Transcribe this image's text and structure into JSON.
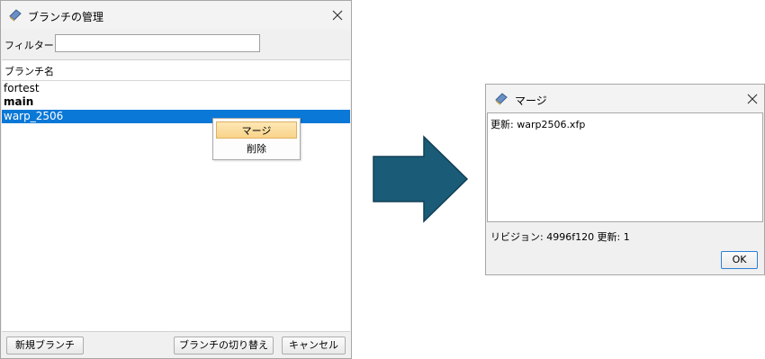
{
  "branch_dialog": {
    "title": "ブランチの管理",
    "filter_label": "フィルター:",
    "filter_value": "",
    "column_header": "ブランチ名",
    "branches": [
      {
        "name": "fortest",
        "bold": false,
        "selected": false
      },
      {
        "name": "main",
        "bold": true,
        "selected": false
      },
      {
        "name": "warp_2506",
        "bold": false,
        "selected": true
      }
    ],
    "context_menu": {
      "merge": "マージ",
      "delete": "削除"
    },
    "buttons": {
      "new_branch": "新規ブランチ",
      "switch_branch": "ブランチの切り替え",
      "cancel": "キャンセル"
    }
  },
  "merge_dialog": {
    "title": "マージ",
    "message": "更新: warp2506.xfp",
    "revision": "リビジョン: 4996f120 更新: 1",
    "ok": "OK"
  },
  "colors": {
    "selection": "#0a78d7",
    "arrow": "#1a5c78",
    "menu_highlight": "#f9d38a"
  },
  "icons": [
    "app-icon",
    "close-icon",
    "arrow-right-icon"
  ]
}
